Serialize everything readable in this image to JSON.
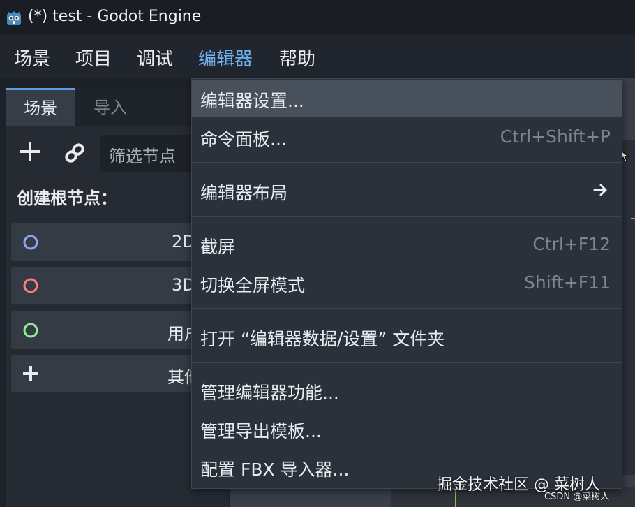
{
  "window": {
    "title": "(*) test - Godot Engine",
    "icon": "godot-robot-icon"
  },
  "menubar": {
    "items": [
      {
        "label": "场景"
      },
      {
        "label": "项目"
      },
      {
        "label": "调试"
      },
      {
        "label": "编辑器",
        "active": true
      },
      {
        "label": "帮助"
      }
    ]
  },
  "scene_dock": {
    "tabs": [
      {
        "label": "场景",
        "active": true
      },
      {
        "label": "导入",
        "active": false
      }
    ],
    "filter_placeholder": "筛选节点",
    "create_root_heading": "创建根节点：",
    "root_buttons": [
      {
        "label": "2D",
        "icon": "circle-blue-icon"
      },
      {
        "label": "3D",
        "icon": "circle-red-icon"
      },
      {
        "label": "用户界面",
        "icon": "circle-green-icon"
      },
      {
        "label": "其他节点",
        "icon": "plus-icon"
      }
    ]
  },
  "editor_menu": {
    "items": [
      {
        "label": "编辑器设置...",
        "shortcut": "",
        "hover": true
      },
      {
        "label": "命令面板...",
        "shortcut": "Ctrl+Shift+P"
      },
      {
        "label": "编辑器布局",
        "shortcut": "",
        "submenu": true
      },
      {
        "label": "截屏",
        "shortcut": "Ctrl+F12"
      },
      {
        "label": "切换全屏模式",
        "shortcut": "Shift+F11"
      },
      {
        "label": "打开 “编辑器数据/设置” 文件夹",
        "shortcut": ""
      },
      {
        "label": "管理编辑器功能...",
        "shortcut": ""
      },
      {
        "label": "管理导出模板...",
        "shortcut": ""
      },
      {
        "label": "配置 FBX 导入器...",
        "shortcut": ""
      }
    ]
  },
  "watermark": {
    "main": "掘金技术社区 @ 菜树人",
    "small": "CSDN @菜树人"
  },
  "colors": {
    "accent": "#5f9ee2",
    "active_menu": "#6fb1ee",
    "node2d": "#8da5f3",
    "node3d": "#fc7f7f",
    "control": "#8eef97"
  }
}
